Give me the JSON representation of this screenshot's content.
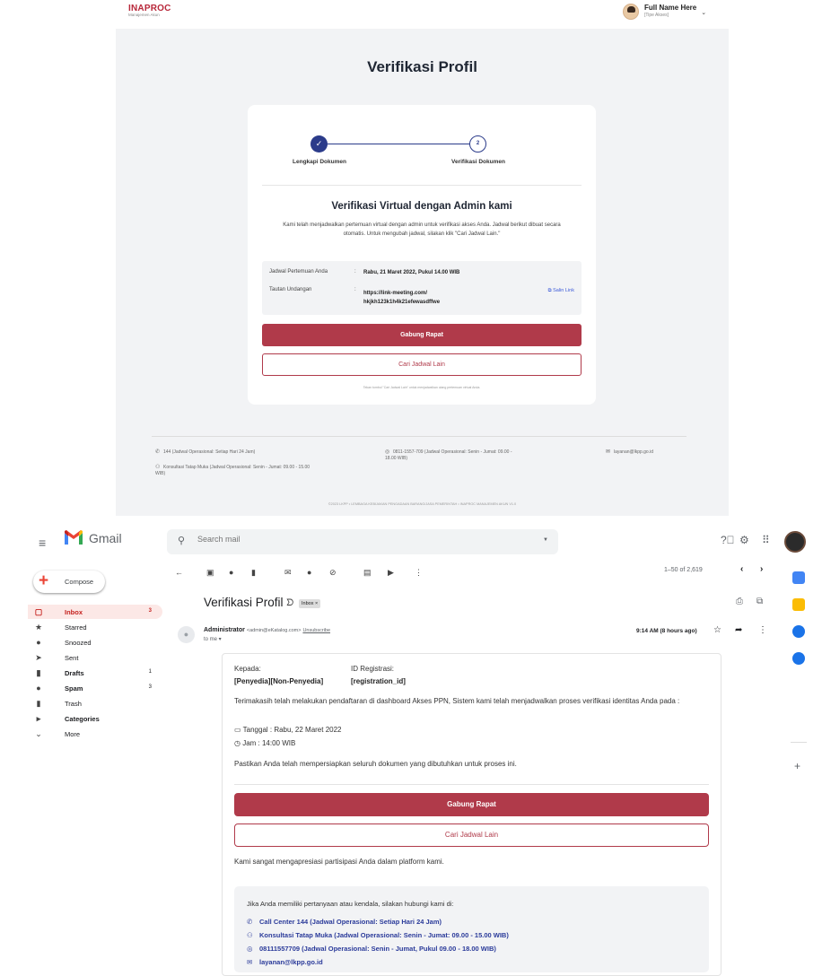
{
  "inaproc": {
    "logo": "INAPROC",
    "logo_sub": "Manajemen Akun",
    "user_name": "Full Name Here",
    "user_role": "[Tipe Akses]",
    "page_title": "Verifikasi Profil",
    "steps": [
      {
        "number": "✓",
        "label": "Lengkapi Dokumen"
      },
      {
        "number": "2",
        "label": "Verifikasi Dokumen"
      }
    ],
    "heading": "Verifikasi Virtual dengan Admin kami",
    "description": "Kami telah menjadwalkan pertemuan virtual dengan admin untuk verifikasi akses Anda. Jadwal berikut dibuat secara otomatis. Untuk mengubah jadwal, silakan klik \"Cari Jadwal Lain.\"",
    "schedule_label": "Jadwal Pertemuan Anda",
    "schedule_value": "Rabu, 21 Maret 2022, Pukul 14.00 WIB",
    "link_label": "Tautan Undangan",
    "link_value": "https://link-meeting.com/ hkjkh123k1h4k21efewasdffwe",
    "copy_link": "Salin Link",
    "join_button": "Gabung Rapat",
    "reschedule_button": "Cari Jadwal Lain",
    "note": "Tekan tombol \"Cari Jadwal Lain\" untuk menjadwalkan ulang pertemuan virtual Anda.",
    "footer": {
      "call_center": "144 (Jadwal Operasional: Setiap Hari 24 Jam)",
      "whatsapp": "0811-1557-709 (Jadwal Operasional: Senin - Jumat: 09.00 - 18.00 WIB)",
      "email": "layanan@lkpp.go.id",
      "face_to_face": "Konsultasi Tatap Muka (Jadwal Operasional: Senin - Jumat: 09.00 - 15.00 WIB)",
      "copyright": "©2023 LKPP • LEMBAGA KEBIJAKAN PENGADAAN BARANG/JASA PEMERINTAH • INAPROC MANAJEMEN AKUN V1.0"
    }
  },
  "gmail": {
    "app_name": "Gmail",
    "search_placeholder": "Search mail",
    "compose": "Compose",
    "sidebar": [
      {
        "label": "Inbox",
        "count": "3",
        "icon": "inbox-icon",
        "glyph": "▢"
      },
      {
        "label": "Starred",
        "count": "",
        "icon": "star-icon",
        "glyph": "★"
      },
      {
        "label": "Snoozed",
        "count": "",
        "icon": "clock-icon",
        "glyph": "●"
      },
      {
        "label": "Sent",
        "count": "",
        "icon": "send-icon",
        "glyph": "➤"
      },
      {
        "label": "Drafts",
        "count": "1",
        "icon": "draft-icon",
        "glyph": "▮"
      },
      {
        "label": "Spam",
        "count": "3",
        "icon": "spam-icon",
        "glyph": "●"
      },
      {
        "label": "Trash",
        "count": "",
        "icon": "trash-icon",
        "glyph": "▮"
      },
      {
        "label": "Categories",
        "count": "",
        "icon": "label-icon",
        "glyph": "▸"
      },
      {
        "label": "More",
        "count": "",
        "icon": "chevron-down-icon",
        "glyph": "⌄"
      }
    ],
    "pager": "1–50 of 2,619",
    "subject": "Verifikasi Profil",
    "inbox_chip": "Inbox ×",
    "sender_name": "Administrator",
    "sender_addr": "<admin@eKatalog.com>",
    "unsubscribe": "Unsubscribe",
    "to": "to me ▾",
    "time": "9:14 AM (8 hours ago)",
    "body": {
      "to_label": "Kepada:",
      "to_value": "[Penyedia][Non-Penyedia]",
      "reg_label": "ID Registrasi:",
      "reg_value": "[registration_id]",
      "paragraph": "Terimakasih telah melakukan pendaftaran di dashboard Akses PPN, Sistem kami telah menjadwalkan proses verifikasi identitas Anda pada :",
      "date": "Tanggal : Rabu, 22 Maret 2022",
      "hour": "Jam : 14:00 WIB",
      "prepare": "Pastikan Anda telah mempersiapkan seluruh dokumen yang dibutuhkan untuk proses ini.",
      "join_button": "Gabung Rapat",
      "reschedule_button": "Cari Jadwal Lain",
      "thanks": "Kami sangat mengapresiasi partisipasi Anda dalam platform kami.",
      "contact_intro": "Jika Anda memiliki pertanyaan atau kendala, silakan hubungi kami di:",
      "contacts": [
        "Call Center 144 (Jadwal Operasional: Setiap Hari 24 Jam)",
        "Konsultasi Tatap Muka (Jadwal Operasional: Senin - Jumat: 09.00 - 15.00 WIB)",
        "08111557709 (Jadwal Operasional: Senin - Jumat, Pukul 09.00 - 18.00 WIB)",
        "layanan@lkpp.go.id"
      ]
    }
  },
  "colors": {
    "accent": "#b03a4a",
    "brand_blue": "#2b3b8a",
    "gmail_red": "#c5221f"
  }
}
